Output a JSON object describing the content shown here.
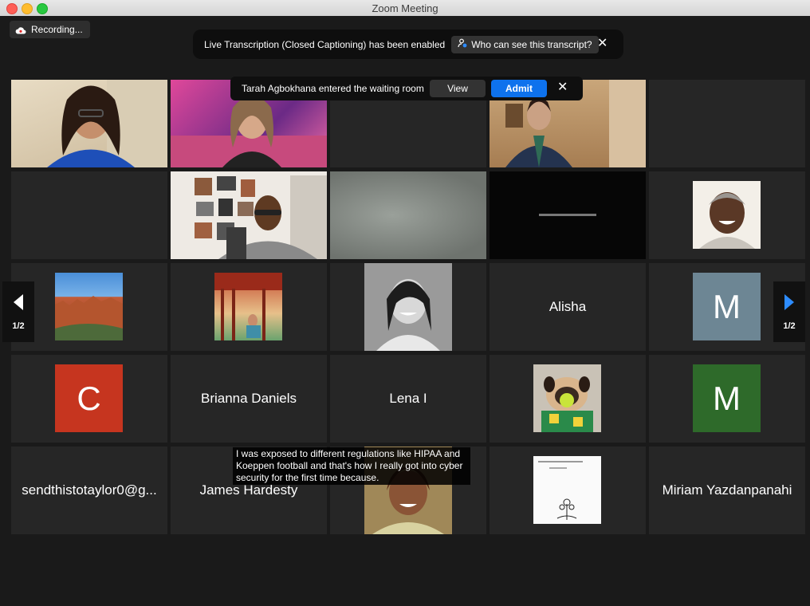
{
  "window": {
    "title": "Zoom Meeting"
  },
  "recording": {
    "label": "Recording..."
  },
  "transcription_banner": {
    "message": "Live Transcription (Closed Captioning) has been enabled",
    "who_can_see": "Who can see this transcript?"
  },
  "waiting_room": {
    "message": "Tarah Agbokhana entered the waiting room",
    "view_label": "View",
    "admit_label": "Admit"
  },
  "pagination": {
    "left": "1/2",
    "right": "1/2"
  },
  "participants": {
    "alisha": "Alisha",
    "m1_letter": "M",
    "c_letter": "C",
    "brianna": "Brianna Daniels",
    "lena": "Lena I",
    "m2_letter": "M",
    "sendthis": "sendthistotaylor0@g...",
    "james": "James Hardesty",
    "miriam": "Miriam Yazdanpanahi"
  },
  "caption": {
    "text": "I was exposed to different regulations like HIPAA and Koeppen football and that's how I really got into cyber security for the first time because."
  },
  "colors": {
    "tile_bg": "#262626",
    "admit_blue": "#0e72ed",
    "active_speaker": "#c6e97a",
    "avatar_m1": "#6d8694",
    "avatar_c": "#c6351f",
    "avatar_m2": "#2e6a2a"
  }
}
